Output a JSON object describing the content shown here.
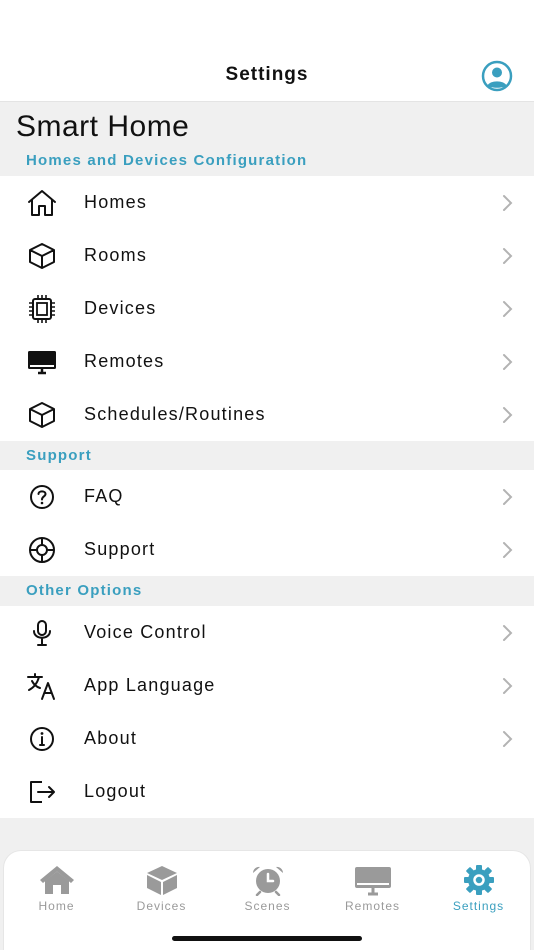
{
  "header": {
    "title": "Settings",
    "profile_icon": "user-circle-icon",
    "accent": "#3a9fbf"
  },
  "page": {
    "heading": "Smart Home"
  },
  "sections": {
    "config": {
      "title": "Homes and Devices Configuration",
      "items": [
        {
          "label": "Homes",
          "icon": "house-icon"
        },
        {
          "label": "Rooms",
          "icon": "cube-icon"
        },
        {
          "label": "Devices",
          "icon": "chip-icon"
        },
        {
          "label": "Remotes",
          "icon": "monitor-icon"
        },
        {
          "label": "Schedules/Routines",
          "icon": "cube-icon"
        }
      ]
    },
    "support": {
      "title": "Support",
      "items": [
        {
          "label": "FAQ",
          "icon": "question-circle-icon"
        },
        {
          "label": "Support",
          "icon": "lifebuoy-icon"
        }
      ]
    },
    "other": {
      "title": "Other Options",
      "items": [
        {
          "label": "Voice Control",
          "icon": "microphone-icon"
        },
        {
          "label": "App Language",
          "icon": "translate-icon"
        },
        {
          "label": "About",
          "icon": "info-circle-icon"
        },
        {
          "label": "Logout",
          "icon": "logout-icon"
        }
      ]
    }
  },
  "tabbar": {
    "active": "Settings",
    "tabs": [
      {
        "label": "Home",
        "icon": "house-icon"
      },
      {
        "label": "Devices",
        "icon": "cube-icon"
      },
      {
        "label": "Scenes",
        "icon": "alarm-clock-icon"
      },
      {
        "label": "Remotes",
        "icon": "monitor-icon"
      },
      {
        "label": "Settings",
        "icon": "gear-icon"
      }
    ]
  }
}
